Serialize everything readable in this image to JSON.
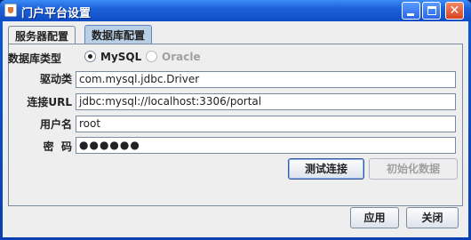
{
  "window": {
    "title": "门户平台设置"
  },
  "tabs": [
    {
      "label": "服务器配置",
      "selected": false
    },
    {
      "label": "数据库配置",
      "selected": true
    }
  ],
  "form": {
    "db_type_label": "数据库类型",
    "radio_options": [
      {
        "label": "MySQL",
        "checked": true,
        "enabled": true
      },
      {
        "label": "Oracle",
        "checked": false,
        "enabled": false
      }
    ],
    "driver_label": "驱动类",
    "driver_value": "com.mysql.jdbc.Driver",
    "url_label": "连接URL",
    "url_value": "jdbc:mysql://localhost:3306/portal",
    "user_label": "用户名",
    "user_value": "root",
    "password_label": "密  码",
    "password_value": "●●●●●●"
  },
  "buttons": {
    "test_connection": "测试连接",
    "init_data": "初始化数据",
    "apply": "应用",
    "close": "关闭"
  },
  "titlebar_buttons": {
    "close_glyph": "✕"
  },
  "colors": {
    "titlebar": "#0d4cc6",
    "client_bg": "#eeeeee",
    "selected_tab": "#b8cfe5"
  }
}
